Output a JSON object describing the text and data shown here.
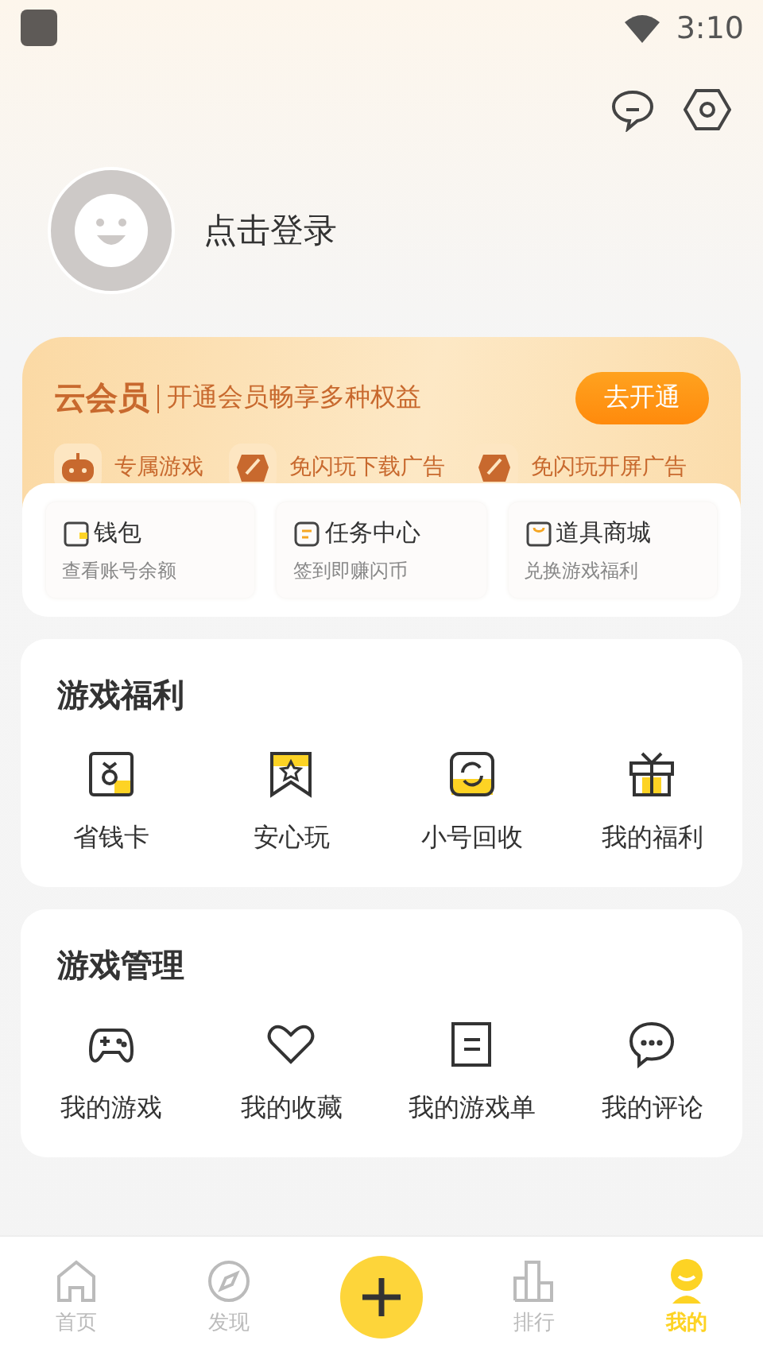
{
  "status_bar": {
    "time": "3:10"
  },
  "profile": {
    "login_text": "点击登录"
  },
  "vip": {
    "brand": "云会员",
    "slogan": "开通会员畅享多种权益",
    "button": "去开通",
    "perks": [
      {
        "kind": "robot",
        "label": "专属游戏"
      },
      {
        "kind": "noad",
        "label": "免闪玩下载广告"
      },
      {
        "kind": "noad",
        "label": "免闪玩开屏广告"
      }
    ]
  },
  "quick": [
    {
      "kind": "wallet",
      "title": "钱包",
      "subtitle": "查看账号余额"
    },
    {
      "kind": "task",
      "title": "任务中心",
      "subtitle": "签到即赚闪币"
    },
    {
      "kind": "shop",
      "title": "道具商城",
      "subtitle": "兑换游戏福利"
    }
  ],
  "sections": [
    {
      "title": "游戏福利",
      "items": [
        {
          "kind": "card",
          "label": "省钱卡"
        },
        {
          "kind": "bookmark",
          "label": "安心玩"
        },
        {
          "kind": "recycle",
          "label": "小号回收"
        },
        {
          "kind": "gift",
          "label": "我的福利"
        }
      ]
    },
    {
      "title": "游戏管理",
      "items": [
        {
          "kind": "gamepad",
          "label": "我的游戏"
        },
        {
          "kind": "heart",
          "label": "我的收藏"
        },
        {
          "kind": "list",
          "label": "我的游戏单"
        },
        {
          "kind": "comment",
          "label": "我的评论"
        }
      ]
    }
  ],
  "nav": [
    {
      "kind": "home",
      "label": "首页",
      "selected": false
    },
    {
      "kind": "compass",
      "label": "发现",
      "selected": false
    },
    {
      "kind": "plus",
      "selected": false
    },
    {
      "kind": "rank",
      "label": "排行",
      "selected": false
    },
    {
      "kind": "me",
      "label": "我的",
      "selected": true
    }
  ]
}
